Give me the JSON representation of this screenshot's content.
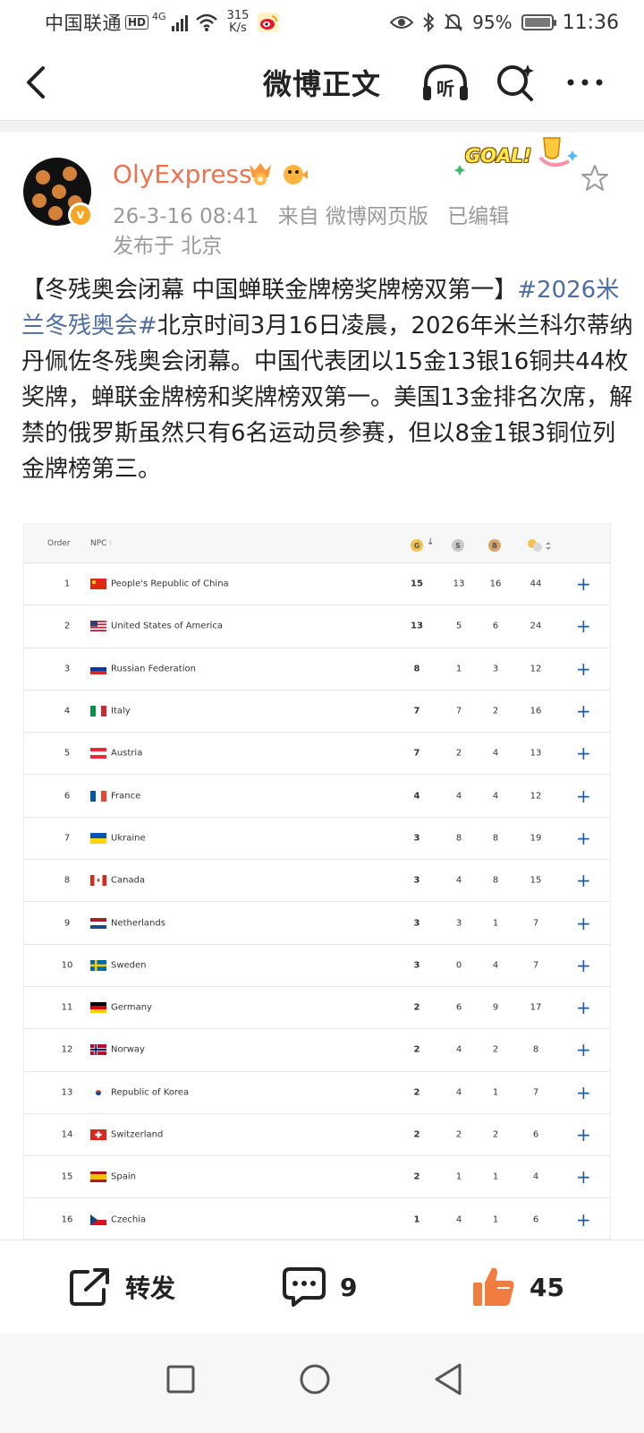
{
  "status_bar": {
    "carrier": "中国联通",
    "hd": "HD",
    "network": "4G",
    "speed_value": "315",
    "speed_unit": "K/s",
    "battery": "95%",
    "time": "11:36",
    "icons": [
      "hd-icon",
      "signal-icon",
      "wifi-icon",
      "weibo-icon",
      "eye-icon",
      "bluetooth-icon",
      "mute-icon",
      "battery-icon"
    ]
  },
  "header": {
    "title": "微博正文",
    "listen_label": "听"
  },
  "post": {
    "author": "OlyExpress",
    "vip_badge": "v",
    "goal_label": "GOAL!",
    "date": "26-3-16 08:41",
    "source": "来自 微博网页版",
    "edited": "已编辑",
    "location": "发布于 北京",
    "headline": "【冬残奥会闭幕 中国蝉联金牌榜奖牌榜双第一】",
    "hashtag": "#2026米兰冬残奥会#",
    "body": "北京时间3月16日凌晨，2026年米兰科尔蒂纳丹佩佐冬残奥会闭幕。中国代表团以15金13银16铜共44枚奖牌，蝉联金牌榜和奖牌榜双第一。美国13金排名次席，解禁的俄罗斯虽然只有6名运动员参赛，但以8金1银3铜位列金牌榜第三。"
  },
  "medal_table": {
    "headers": {
      "order": "Order",
      "npc": "NPC",
      "gold": "G",
      "silver": "S",
      "bronze": "B"
    },
    "colors": {
      "gold": "#f2c14e",
      "silver": "#c9c9c9",
      "bronze": "#d9a46a",
      "plus": "#1a5ca8"
    },
    "rows": [
      {
        "order": "1",
        "flag": "cn",
        "name": "People's Republic of China",
        "gold": "15",
        "silver": "13",
        "bronze": "16",
        "total": "44"
      },
      {
        "order": "2",
        "flag": "us",
        "name": "United States of America",
        "gold": "13",
        "silver": "5",
        "bronze": "6",
        "total": "24"
      },
      {
        "order": "3",
        "flag": "ru",
        "name": "Russian Federation",
        "gold": "8",
        "silver": "1",
        "bronze": "3",
        "total": "12"
      },
      {
        "order": "4",
        "flag": "it",
        "name": "Italy",
        "gold": "7",
        "silver": "7",
        "bronze": "2",
        "total": "16"
      },
      {
        "order": "5",
        "flag": "at",
        "name": "Austria",
        "gold": "7",
        "silver": "2",
        "bronze": "4",
        "total": "13"
      },
      {
        "order": "6",
        "flag": "fr",
        "name": "France",
        "gold": "4",
        "silver": "4",
        "bronze": "4",
        "total": "12"
      },
      {
        "order": "7",
        "flag": "ua",
        "name": "Ukraine",
        "gold": "3",
        "silver": "8",
        "bronze": "8",
        "total": "19"
      },
      {
        "order": "8",
        "flag": "ca",
        "name": "Canada",
        "gold": "3",
        "silver": "4",
        "bronze": "8",
        "total": "15"
      },
      {
        "order": "9",
        "flag": "nl",
        "name": "Netherlands",
        "gold": "3",
        "silver": "3",
        "bronze": "1",
        "total": "7"
      },
      {
        "order": "10",
        "flag": "se",
        "name": "Sweden",
        "gold": "3",
        "silver": "0",
        "bronze": "4",
        "total": "7"
      },
      {
        "order": "11",
        "flag": "de",
        "name": "Germany",
        "gold": "2",
        "silver": "6",
        "bronze": "9",
        "total": "17"
      },
      {
        "order": "12",
        "flag": "no",
        "name": "Norway",
        "gold": "2",
        "silver": "4",
        "bronze": "2",
        "total": "8"
      },
      {
        "order": "13",
        "flag": "kr",
        "name": "Republic of Korea",
        "gold": "2",
        "silver": "4",
        "bronze": "1",
        "total": "7"
      },
      {
        "order": "14",
        "flag": "ch",
        "name": "Switzerland",
        "gold": "2",
        "silver": "2",
        "bronze": "2",
        "total": "6"
      },
      {
        "order": "15",
        "flag": "es",
        "name": "Spain",
        "gold": "2",
        "silver": "1",
        "bronze": "1",
        "total": "4"
      },
      {
        "order": "16",
        "flag": "cz",
        "name": "Czechia",
        "gold": "1",
        "silver": "4",
        "bronze": "1",
        "total": "6"
      }
    ]
  },
  "actions": {
    "repost_label": "转发",
    "comment_count": "9",
    "like_count": "45",
    "like_color": "#f07d3f"
  }
}
